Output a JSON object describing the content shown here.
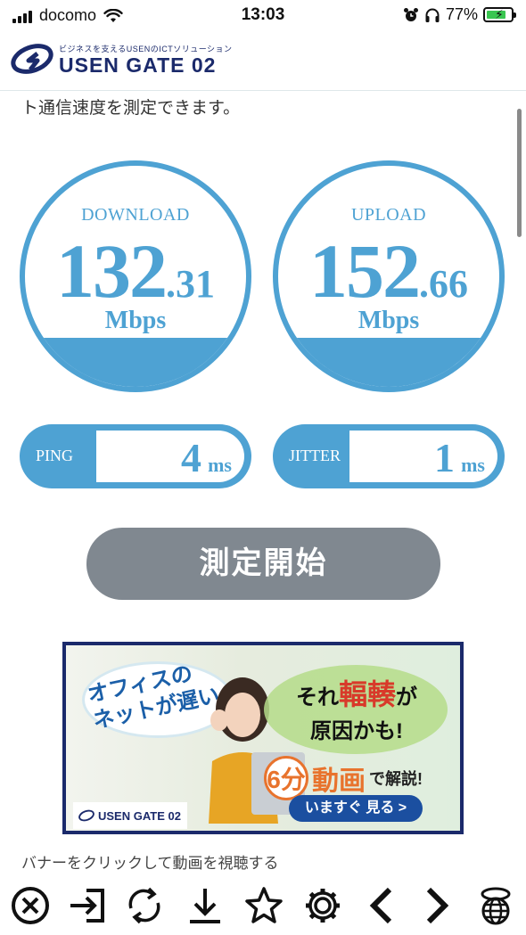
{
  "status_bar": {
    "carrier": "docomo",
    "time": "13:03",
    "battery": "77%",
    "battery_level": 0.77
  },
  "header": {
    "tagline": "ビジネスを支えるUSENのICTソリューション",
    "brand": "USEN GATE 02"
  },
  "intro_text": "ト通信速度を測定できます。",
  "download": {
    "label": "DOWNLOAD",
    "value_int": "132",
    "value_dec": ".31",
    "unit": "Mbps",
    "fill_fraction": 0.22
  },
  "upload": {
    "label": "UPLOAD",
    "value_int": "152",
    "value_dec": ".66",
    "unit": "Mbps",
    "fill_fraction": 0.22
  },
  "ping": {
    "label": "PING",
    "value": "4",
    "unit": "ms"
  },
  "jitter": {
    "label": "JITTER",
    "value": "1",
    "unit": "ms"
  },
  "start_button": "測定開始",
  "banner": {
    "line1": "オフィスの\nネットが遅い…",
    "line2_pre": "それ",
    "line2_red": "輻輳",
    "line2_post": "が",
    "line3": "原因かも!",
    "minutes": "6分",
    "video": "動画",
    "explain": "で解説!",
    "cta": "いますぐ 見る >",
    "logo": "USEN GATE 02"
  },
  "caption": "バナーをクリックして動画を視聴する",
  "toolbar": {
    "items": [
      "close-icon",
      "open-in-icon",
      "reload-icon",
      "download-icon",
      "star-icon",
      "gear-icon",
      "back-icon",
      "forward-icon",
      "globe-icon"
    ]
  },
  "colors": {
    "accent": "#4ea2d3",
    "brand": "#1b2a6b",
    "button": "#808890"
  }
}
